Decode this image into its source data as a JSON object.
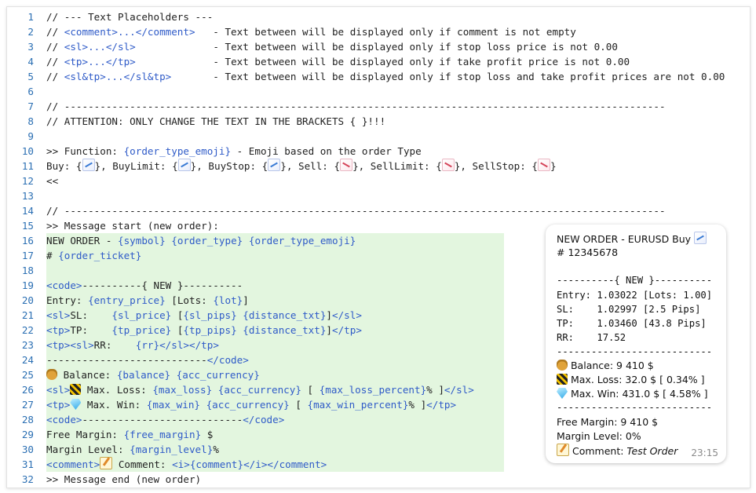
{
  "editor": {
    "lines": [
      {
        "n": "1",
        "parts": [
          [
            "c",
            "// --- Text Placeholders ---"
          ]
        ]
      },
      {
        "n": "2",
        "parts": [
          [
            "c",
            "// "
          ],
          [
            "t",
            "<comment>...</comment>"
          ],
          [
            "c",
            "   - Text between will be displayed only if comment is not empty"
          ]
        ]
      },
      {
        "n": "3",
        "parts": [
          [
            "c",
            "// "
          ],
          [
            "t",
            "<sl>...</sl>"
          ],
          [
            "c",
            "             - Text between will be displayed only if stop loss price is not 0.00"
          ]
        ]
      },
      {
        "n": "4",
        "parts": [
          [
            "c",
            "// "
          ],
          [
            "t",
            "<tp>...</tp>"
          ],
          [
            "c",
            "             - Text between will be displayed only if take profit price is not 0.00"
          ]
        ]
      },
      {
        "n": "5",
        "parts": [
          [
            "c",
            "// "
          ],
          [
            "t",
            "<sl&tp>...</sl&tp>"
          ],
          [
            "c",
            "       - Text between will be displayed only if stop loss and take profit prices are not 0.00"
          ]
        ]
      },
      {
        "n": "6",
        "parts": []
      },
      {
        "n": "7",
        "parts": [
          [
            "c",
            "// -----------------------------------------------------------------------------------------------------"
          ]
        ]
      },
      {
        "n": "8",
        "parts": [
          [
            "c",
            "// ATTENTION: ONLY CHANGE THE TEXT IN THE BRACKETS { }!!!"
          ]
        ]
      },
      {
        "n": "9",
        "parts": []
      },
      {
        "n": "10",
        "parts": [
          [
            "c",
            ">> Function: "
          ],
          [
            "v",
            "{order_type_emoji}"
          ],
          [
            "c",
            " - Emoji based on the order Type"
          ]
        ]
      },
      {
        "n": "11",
        "parts": [
          [
            "c",
            "Buy: {"
          ],
          [
            "e",
            "chart-up"
          ],
          [
            "c",
            "}, BuyLimit: {"
          ],
          [
            "e",
            "chart-up"
          ],
          [
            "c",
            "}, BuyStop: {"
          ],
          [
            "e",
            "chart-up"
          ],
          [
            "c",
            "}, Sell: {"
          ],
          [
            "e",
            "chart-down"
          ],
          [
            "c",
            "}, SellLimit: {"
          ],
          [
            "e",
            "chart-down"
          ],
          [
            "c",
            "}, SellStop: {"
          ],
          [
            "e",
            "chart-down"
          ],
          [
            "c",
            "}"
          ]
        ]
      },
      {
        "n": "12",
        "parts": [
          [
            "c",
            "<<"
          ]
        ]
      },
      {
        "n": "13",
        "parts": []
      },
      {
        "n": "14",
        "parts": [
          [
            "c",
            "// -----------------------------------------------------------------------------------------------------"
          ]
        ]
      },
      {
        "n": "15",
        "parts": [
          [
            "c",
            ">> Message start (new order):"
          ]
        ]
      },
      {
        "n": "16",
        "hl": true,
        "parts": [
          [
            "c",
            "NEW ORDER - "
          ],
          [
            "v",
            "{symbol}"
          ],
          [
            "c",
            " "
          ],
          [
            "v",
            "{order_type}"
          ],
          [
            "c",
            " "
          ],
          [
            "v",
            "{order_type_emoji}"
          ]
        ]
      },
      {
        "n": "17",
        "hl": true,
        "parts": [
          [
            "c",
            "# "
          ],
          [
            "v",
            "{order_ticket}"
          ]
        ]
      },
      {
        "n": "18",
        "hl": true,
        "parts": []
      },
      {
        "n": "19",
        "hl": true,
        "parts": [
          [
            "t",
            "<code>"
          ],
          [
            "c",
            "----------{ NEW }----------"
          ]
        ]
      },
      {
        "n": "20",
        "hl": true,
        "parts": [
          [
            "c",
            "Entry: "
          ],
          [
            "v",
            "{entry_price}"
          ],
          [
            "c",
            " [Lots: "
          ],
          [
            "v",
            "{lot}"
          ],
          [
            "c",
            "]"
          ]
        ]
      },
      {
        "n": "21",
        "hl": true,
        "parts": [
          [
            "t",
            "<sl>"
          ],
          [
            "c",
            "SL:    "
          ],
          [
            "v",
            "{sl_price}"
          ],
          [
            "c",
            " ["
          ],
          [
            "v",
            "{sl_pips}"
          ],
          [
            "c",
            " "
          ],
          [
            "v",
            "{distance_txt}"
          ],
          [
            "c",
            "]"
          ],
          [
            "t",
            "</sl>"
          ]
        ]
      },
      {
        "n": "22",
        "hl": true,
        "parts": [
          [
            "t",
            "<tp>"
          ],
          [
            "c",
            "TP:    "
          ],
          [
            "v",
            "{tp_price}"
          ],
          [
            "c",
            " ["
          ],
          [
            "v",
            "{tp_pips}"
          ],
          [
            "c",
            " "
          ],
          [
            "v",
            "{distance_txt}"
          ],
          [
            "c",
            "]"
          ],
          [
            "t",
            "</tp>"
          ]
        ]
      },
      {
        "n": "23",
        "hl": true,
        "parts": [
          [
            "t",
            "<tp><sl>"
          ],
          [
            "c",
            "RR:    "
          ],
          [
            "v",
            "{rr}"
          ],
          [
            "t",
            "</sl></tp>"
          ]
        ]
      },
      {
        "n": "24",
        "hl": true,
        "parts": [
          [
            "c",
            "---------------------------"
          ],
          [
            "t",
            "</code>"
          ]
        ]
      },
      {
        "n": "25",
        "hl": true,
        "parts": [
          [
            "e",
            "bag"
          ],
          [
            "c",
            " Balance: "
          ],
          [
            "v",
            "{balance}"
          ],
          [
            "c",
            " "
          ],
          [
            "v",
            "{acc_currency}"
          ]
        ]
      },
      {
        "n": "26",
        "hl": true,
        "parts": [
          [
            "t",
            "<sl>"
          ],
          [
            "e",
            "warn"
          ],
          [
            "c",
            " Max. Loss: "
          ],
          [
            "v",
            "{max_loss}"
          ],
          [
            "c",
            " "
          ],
          [
            "v",
            "{acc_currency}"
          ],
          [
            "c",
            " [ "
          ],
          [
            "v",
            "{max_loss_percent}"
          ],
          [
            "c",
            "% ]"
          ],
          [
            "t",
            "</sl>"
          ]
        ]
      },
      {
        "n": "27",
        "hl": true,
        "parts": [
          [
            "t",
            "<tp>"
          ],
          [
            "e",
            "gem"
          ],
          [
            "c",
            " Max. Win: "
          ],
          [
            "v",
            "{max_win}"
          ],
          [
            "c",
            " "
          ],
          [
            "v",
            "{acc_currency}"
          ],
          [
            "c",
            " [ "
          ],
          [
            "v",
            "{max_win_percent}"
          ],
          [
            "c",
            "% ]"
          ],
          [
            "t",
            "</tp>"
          ]
        ]
      },
      {
        "n": "28",
        "hl": true,
        "parts": [
          [
            "t",
            "<code>"
          ],
          [
            "c",
            "---------------------------"
          ],
          [
            "t",
            "</code>"
          ]
        ]
      },
      {
        "n": "29",
        "hl": true,
        "parts": [
          [
            "c",
            "Free Margin: "
          ],
          [
            "v",
            "{free_margin}"
          ],
          [
            "c",
            " $"
          ]
        ]
      },
      {
        "n": "30",
        "hl": true,
        "parts": [
          [
            "c",
            "Margin Level: "
          ],
          [
            "v",
            "{margin_level}"
          ],
          [
            "c",
            "%"
          ]
        ]
      },
      {
        "n": "31",
        "hl": true,
        "parts": [
          [
            "t",
            "<comment>"
          ],
          [
            "e",
            "memo"
          ],
          [
            "c",
            " Comment: "
          ],
          [
            "t",
            "<i>"
          ],
          [
            "v",
            "{comment}"
          ],
          [
            "t",
            "</i></comment>"
          ]
        ]
      },
      {
        "n": "32",
        "parts": [
          [
            "c",
            ">> Message end (new order)"
          ]
        ]
      }
    ]
  },
  "preview": {
    "title": "NEW ORDER - EURUSD Buy",
    "ticket": "# 12345678",
    "code_header": "----------{ NEW }----------",
    "entry_line": "Entry: 1.03022 [Lots: 1.00]",
    "sl_line": "SL:    1.02997 [2.5 Pips]",
    "tp_line": "TP:    1.03460 [43.8 Pips]",
    "rr_line": "RR:    17.52",
    "code_footer": "---------------------------",
    "balance": "Balance: 9 410 $",
    "max_loss": "Max. Loss: 32.0 $ [ 0.34% ]",
    "max_win": "Max. Win: 431.0 $ [ 4.58% ]",
    "free_margin": "Free Margin: 9 410 $",
    "margin_level": "Margin Level: 0%",
    "comment_label": "Comment: ",
    "comment_value": "Test Order",
    "time": "23:15"
  }
}
